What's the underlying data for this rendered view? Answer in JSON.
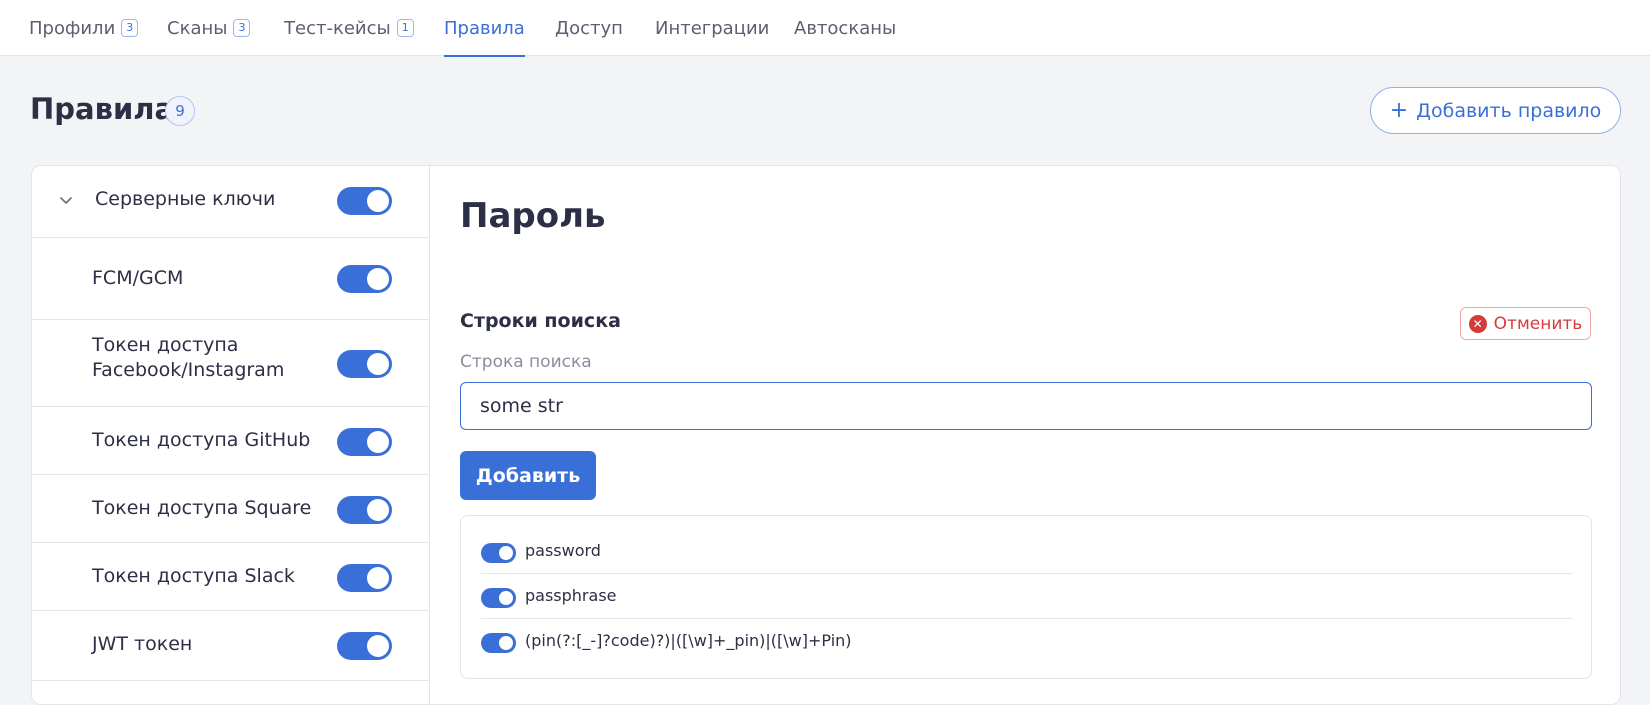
{
  "nav": {
    "tabs": [
      {
        "label": "Профили",
        "count": "3"
      },
      {
        "label": "Сканы",
        "count": "3"
      },
      {
        "label": "Тест-кейсы",
        "count": "1"
      },
      {
        "label": "Правила",
        "count": ""
      },
      {
        "label": "Доступ",
        "count": ""
      },
      {
        "label": "Интеграции",
        "count": ""
      },
      {
        "label": "Автосканы",
        "count": ""
      }
    ],
    "active_tab": "Правила"
  },
  "header": {
    "title": "Правила",
    "count": "9",
    "add_rule_label": "Добавить правило",
    "add_rule_icon": "plus-icon"
  },
  "sidebar": {
    "group": {
      "label": "Серверные ключи",
      "expanded": true,
      "enabled": true,
      "icon": "chevron-down-icon"
    },
    "rules": [
      {
        "label": "FCM/GCM",
        "enabled": true
      },
      {
        "label": "Токен доступа Facebook/Instagram",
        "enabled": true
      },
      {
        "label": "Токен доступа GitHub",
        "enabled": true
      },
      {
        "label": "Токен доступа Square",
        "enabled": true
      },
      {
        "label": "Токен доступа Slack",
        "enabled": true
      },
      {
        "label": "JWT токен",
        "enabled": true
      }
    ]
  },
  "main": {
    "rule_title": "Пароль",
    "section_title": "Строки поиска",
    "cancel_label": "Отменить",
    "cancel_icon": "close-circle-icon",
    "field_label": "Строка поиска",
    "search_value": "some str",
    "add_label": "Добавить",
    "strings": [
      {
        "text": "password",
        "enabled": true
      },
      {
        "text": "passphrase",
        "enabled": true
      },
      {
        "text": "(pin(?:[_-]?code)?)|([\\w]+_pin)|([\\w]+Pin)",
        "enabled": true
      }
    ]
  },
  "colors": {
    "accent": "#3b6fd8",
    "danger": "#d63a3a",
    "background": "#f3f4f6",
    "text": "#2c2f45"
  }
}
